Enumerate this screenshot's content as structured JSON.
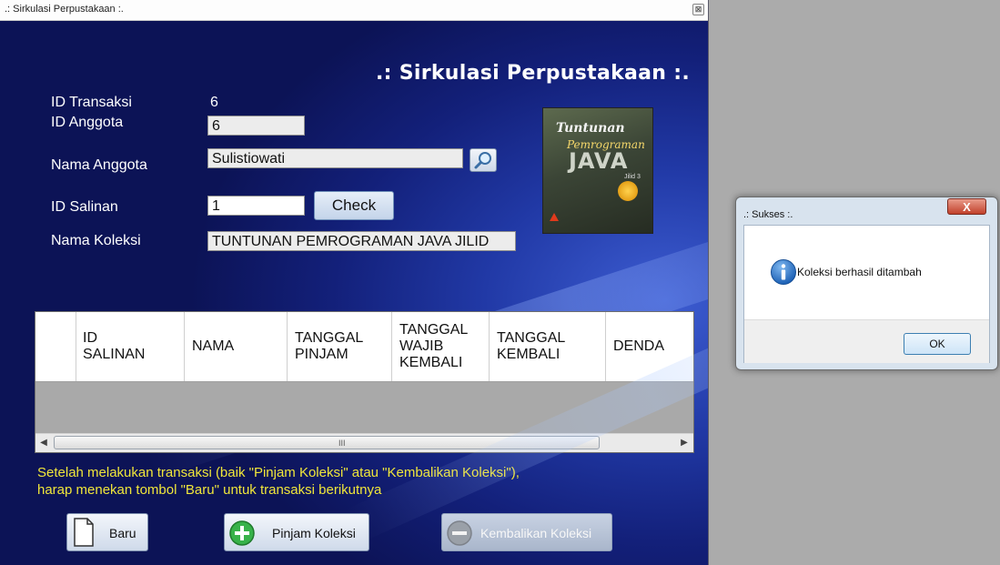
{
  "main_window": {
    "title": ".: Sirkulasi Perpustakaan :.",
    "close_glyph": "⊠",
    "heading": ".: Sirkulasi Perpustakaan :."
  },
  "form": {
    "id_transaksi_label": "ID Transaksi",
    "id_transaksi_value": "6",
    "id_anggota_label": "ID Anggota",
    "id_anggota_value": "6",
    "nama_anggota_label": "Nama Anggota",
    "nama_anggota_value": "Sulistiowati",
    "id_salinan_label": "ID Salinan",
    "id_salinan_value": "1",
    "check_label": "Check",
    "nama_koleksi_label": "Nama Koleksi",
    "nama_koleksi_value": "TUNTUNAN PEMROGRAMAN JAVA JILID"
  },
  "book_cover": {
    "title_line1": "Tuntunan",
    "title_line2": "Pemrograman",
    "title_line3": "JAVA",
    "volume": "Jilid 3"
  },
  "grid": {
    "columns": [
      [
        "ID",
        "SALINAN"
      ],
      [
        "NAMA"
      ],
      [
        "TANGGAL",
        "PINJAM"
      ],
      [
        "TANGGAL",
        "WAJIB",
        "KEMBALI"
      ],
      [
        "TANGGAL",
        "KEMBALI"
      ],
      [
        "DENDA"
      ]
    ],
    "scroll_grip": "III"
  },
  "note": {
    "line1": "Setelah melakukan transaksi (baik \"Pinjam Koleksi\" atau \"Kembalikan Koleksi\"),",
    "line2": "harap menekan tombol \"Baru\" untuk transaksi berikutnya"
  },
  "buttons": {
    "baru": "Baru",
    "pinjam": "Pinjam Koleksi",
    "kembalikan": "Kembalikan Koleksi"
  },
  "dialog": {
    "title": ".: Sukses :.",
    "close_glyph": "X",
    "message": "Koleksi berhasil ditambah",
    "ok_label": "OK",
    "icon": "info-icon"
  },
  "colors": {
    "window_blue": "#13207a",
    "note_yellow": "#f0e63a",
    "desktop_gray": "#ababab"
  }
}
